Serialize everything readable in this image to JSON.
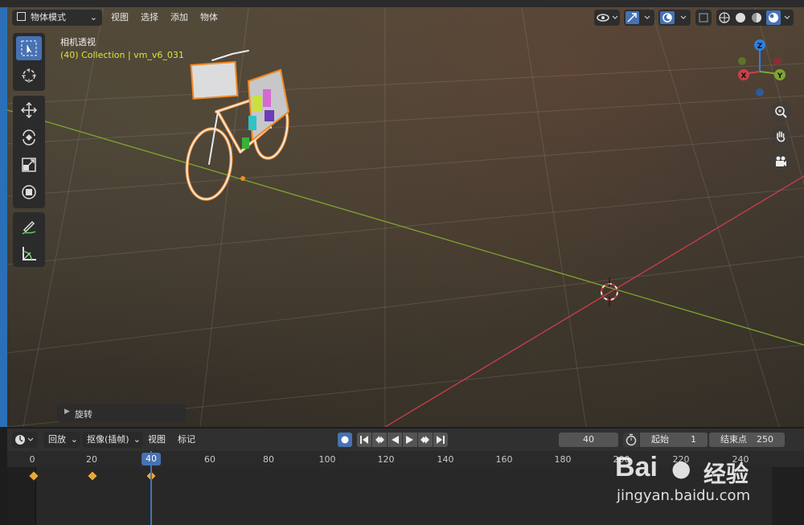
{
  "viewport_header": {
    "mode_label": "物体模式",
    "menus": [
      "视图",
      "选择",
      "添加",
      "物体"
    ]
  },
  "overlay": {
    "view_name": "相机透视",
    "collection_info": "(40) Collection | vm_v6_031"
  },
  "last_operator": {
    "label": "旋转"
  },
  "gizmo": {
    "z": "Z",
    "y": "Y",
    "x": "X"
  },
  "timeline": {
    "menus": [
      "回放",
      "抠像(插帧)",
      "视图",
      "标记"
    ],
    "current_frame": "40",
    "start_label": "起始",
    "start_value": "1",
    "end_label": "结束点",
    "end_value": "250",
    "ticks": [
      "0",
      "20",
      "40",
      "60",
      "80",
      "100",
      "120",
      "140",
      "160",
      "180",
      "200",
      "220",
      "240"
    ]
  },
  "watermark": {
    "brand": "Bai",
    "brand2": "经验",
    "url": "jingyan.baidu.com"
  },
  "colors": {
    "accent": "#4772b3",
    "x_axis": "#c7424a",
    "y_axis": "#7ea62f",
    "z_axis": "#2f7fe0",
    "selection": "#f08a24",
    "keyframe": "#e8a93a"
  }
}
